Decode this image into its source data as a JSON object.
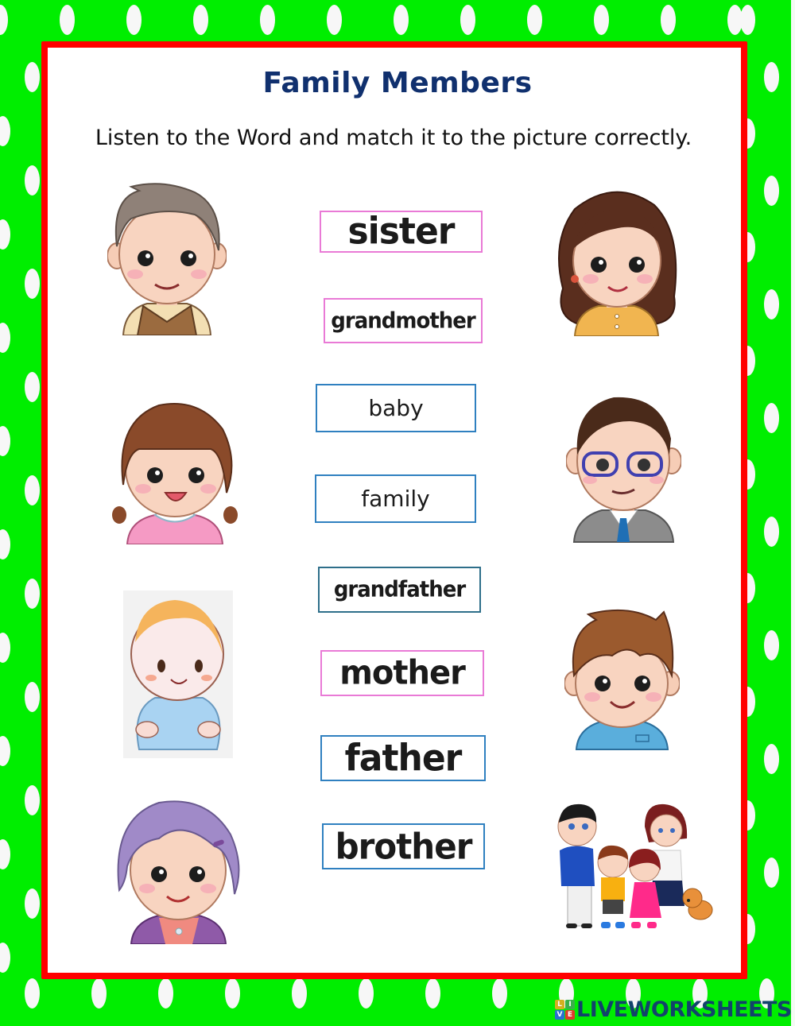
{
  "worksheet": {
    "title": "Family Members",
    "instruction": "Listen to the Word and match it to the picture correctly.",
    "colors": {
      "background": "#00ee00",
      "dots": "#f7f7f7",
      "frame_border": "#ff0000",
      "title": "#10306e"
    }
  },
  "word_cards": [
    {
      "label": "sister",
      "border": "pink"
    },
    {
      "label": "grandmother",
      "border": "pink"
    },
    {
      "label": "baby",
      "border": "blue"
    },
    {
      "label": "family",
      "border": "blue"
    },
    {
      "label": "grandfather",
      "border": "teal"
    },
    {
      "label": "mother",
      "border": "pink"
    },
    {
      "label": "father",
      "border": "blue"
    },
    {
      "label": "brother",
      "border": "blue"
    }
  ],
  "pictures": {
    "left": [
      "grandfather",
      "sister",
      "baby",
      "grandmother"
    ],
    "right": [
      "mother",
      "father",
      "brother",
      "family"
    ]
  },
  "branding": {
    "logo_letters": [
      "L",
      "I",
      "V",
      "E"
    ],
    "logo_text": "LIVEWORKSHEETS"
  }
}
